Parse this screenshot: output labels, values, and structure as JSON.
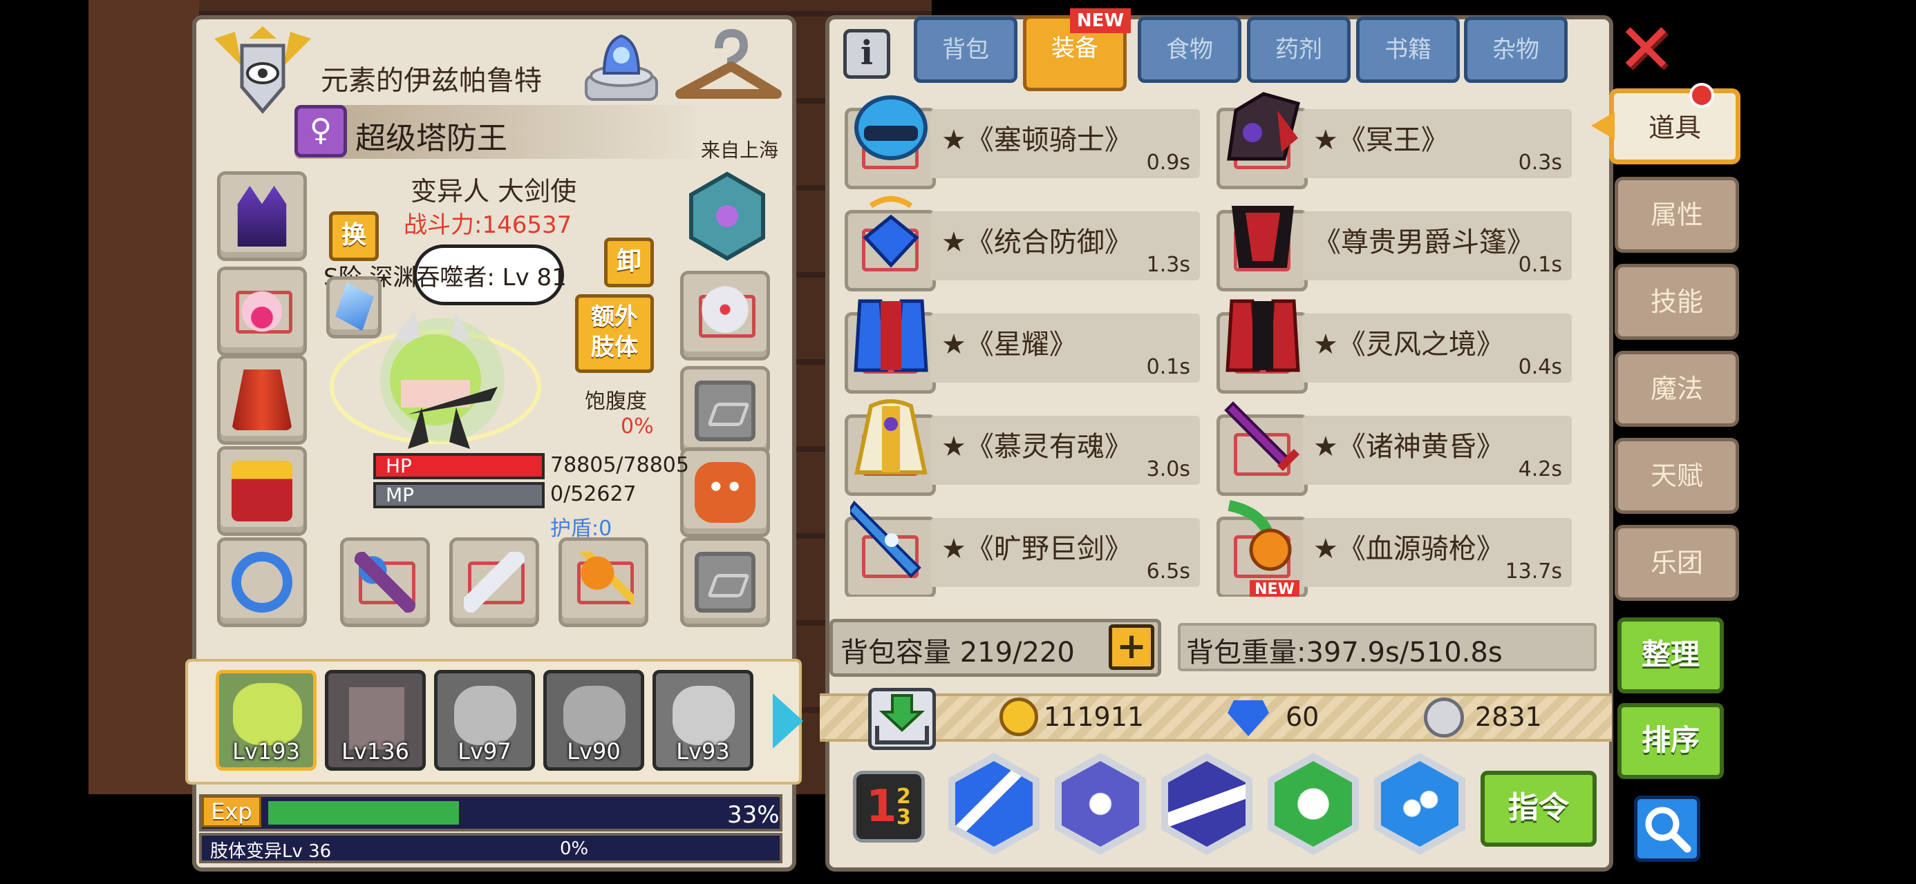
{
  "character": {
    "name": "元素的伊兹帕鲁特",
    "title": "超级塔防王",
    "origin": "来自上海",
    "race_class": "变异人 大剑使",
    "power_label": "战斗力:146537",
    "swap_label": "换",
    "unequip_label": "卸",
    "pet_info": "S阶 深渊吞噬者: Lv 81",
    "extra_limb_label": "额外\n肢体",
    "satiety_label": "饱腹度",
    "satiety_value": "0%",
    "hp_label": "HP",
    "hp_value": "78805/78805",
    "hp_ratio": 1.0,
    "mp_label": "MP",
    "mp_value": "0/52627",
    "mp_ratio": 0.0,
    "shield_label": "护盾:0",
    "exp_label": "Exp",
    "exp_percent": "33%",
    "exp_ratio": 0.33,
    "mutation_label": "肢体变异Lv 36",
    "mutation_percent": "0%",
    "mutation_ratio": 0.0
  },
  "party": [
    {
      "lv": "Lv193"
    },
    {
      "lv": "Lv136"
    },
    {
      "lv": "Lv97"
    },
    {
      "lv": "Lv90"
    },
    {
      "lv": "Lv93"
    }
  ],
  "tabs": [
    {
      "label": "背包"
    },
    {
      "label": "装备",
      "badge": "NEW"
    },
    {
      "label": "食物"
    },
    {
      "label": "药剂"
    },
    {
      "label": "书籍"
    },
    {
      "label": "杂物"
    }
  ],
  "side_tabs": [
    {
      "label": "道具"
    },
    {
      "label": "属性"
    },
    {
      "label": "技能"
    },
    {
      "label": "魔法"
    },
    {
      "label": "天赋"
    },
    {
      "label": "乐团"
    }
  ],
  "items": [
    {
      "name": "★《塞顿骑士》",
      "time": "0.9s"
    },
    {
      "name": "★《冥王》",
      "time": "0.3s"
    },
    {
      "name": "★《统合防御》",
      "time": "1.3s"
    },
    {
      "name": "《尊贵男爵斗篷》",
      "time": "0.1s"
    },
    {
      "name": "★《星耀》",
      "time": "0.1s"
    },
    {
      "name": "★《灵风之境》",
      "time": "0.4s"
    },
    {
      "name": "★《慕灵有魂》",
      "time": "3.0s"
    },
    {
      "name": "★《诸神黄昏》",
      "time": "4.2s"
    },
    {
      "name": "★《旷野巨剑》",
      "time": "6.5s"
    },
    {
      "name": "★《血源骑枪》",
      "time": "13.7s",
      "badge": "NEW"
    }
  ],
  "bag": {
    "capacity_label": "背包容量 219/220",
    "weight_label": "背包重量:397.9s/510.8s",
    "gold": "111911",
    "diamond": "60",
    "silver": "2831"
  },
  "buttons": {
    "organize": "整理",
    "sort": "排序",
    "command": "指令",
    "close": "✕"
  },
  "colors": {
    "hp_bar": "#e8242c",
    "mp_bar": "#6a6f78",
    "exp_bar": "#37b04a",
    "active_tab": "#f2aa2a",
    "tab": "#5f86b6",
    "close_button": "#e23a3a",
    "power_text": "#e23b2b",
    "shield_text": "#3f7fe0"
  },
  "icons": {
    "info": "info-icon",
    "close": "close-x-icon",
    "search": "magnifier-icon",
    "add": "plus-icon",
    "deposit": "download-tray-icon"
  }
}
